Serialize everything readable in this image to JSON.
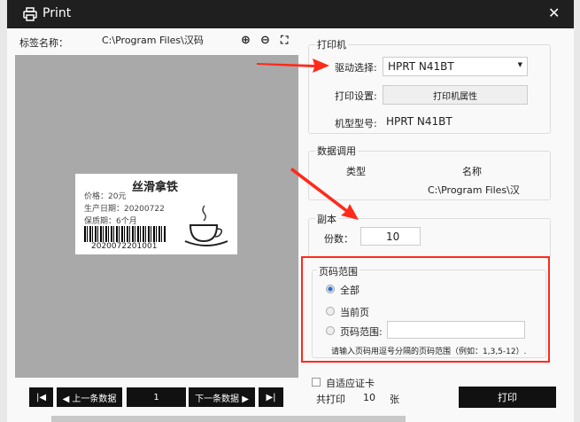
{
  "window": {
    "title": "Print",
    "close": "✕"
  },
  "header": {
    "label_name_label": "标签名称：",
    "label_name_value": "C:\\Program Files\\汉码"
  },
  "label": {
    "title": "丝滑拿铁",
    "price": "价格：20元",
    "date": "生产日期：20200722",
    "shelf": "保质期：6个月",
    "barcode": "2020072201001"
  },
  "nav": {
    "prev": "◀ 上一条数据",
    "page": "1",
    "next": "下一条数据 ▶",
    "first": "|◀",
    "last": "▶|"
  },
  "printer": {
    "group": "打印机",
    "driver_label": "驱动选择:",
    "driver_value": "HPRT N41BT",
    "settings_label": "打印设置:",
    "settings_button": "打印机属性",
    "model_label": "机型型号:",
    "model_value": "HPRT N41BT"
  },
  "data_source": {
    "group": "数据调用",
    "col_type": "类型",
    "col_name": "名称",
    "name_value": "C:\\Program Files\\汉"
  },
  "copies": {
    "group": "副本",
    "label": "份数：",
    "value": "10"
  },
  "page_range": {
    "group": "页码范围",
    "all": "全部",
    "current": "当前页",
    "range": "页码范围:",
    "range_value": "",
    "hint": "请输入页码用逗号分隔的页码范围（例如：1,3,5-12）."
  },
  "footer": {
    "adaptive": "自适应证卡",
    "total_label": "共打印",
    "total_value": "10",
    "unit": "张",
    "print": "打印"
  },
  "colors": {
    "annotation": "#ff2a1a",
    "titlebar": "#1f1f1f"
  }
}
